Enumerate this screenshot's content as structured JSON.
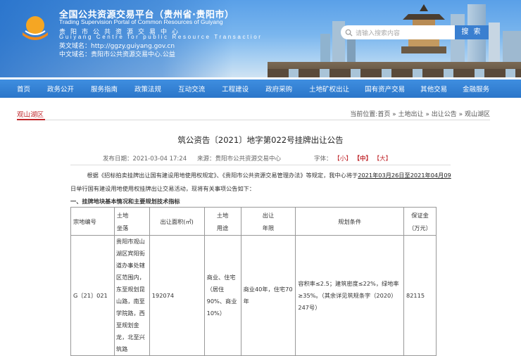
{
  "header": {
    "title_cn": "全国公共资源交易平台（贵州省·贵阳市）",
    "title_en": "Trading Supervision Portal of Common Resources of Guiyang",
    "subtitle_cn": "贵阳市公共资源交易中心",
    "subtitle_en": "Guiyang Centre for public Resource Transactior",
    "domain_en": "英文域名：http://ggzy.guiyang.gov.cn",
    "domain_cn": "中文域名：贵阳市公共资源交易中心.公益",
    "search_placeholder": "请输入搜索内容",
    "search_button": "搜 索"
  },
  "nav": {
    "items": [
      "首页",
      "政务公开",
      "服务指南",
      "政策法规",
      "互动交流",
      "工程建设",
      "政府采购",
      "土地矿权出让",
      "国有资产交易",
      "其他交易",
      "金融服务"
    ]
  },
  "breadcrumb": {
    "section": "观山湖区",
    "path": "当前位置:首页 » 土地出让 » 出让公告 » 观山湖区"
  },
  "article": {
    "title": "筑公资告〔2021〕地字第022号挂牌出让公告",
    "date": "发布日期：2021-03-04 17:24",
    "source": "来源：贵阳市公共资源交易中心",
    "font_label": "字体：",
    "font_small": "【小】",
    "font_medium": "【中】",
    "font_large": "【大】",
    "para1_pre": "根据《招标拍卖挂牌出让国有建设用地使用权规定》、《贵阳市公共资源交易管理办法》等规定，我中心将于",
    "para1_date1": "2021年03月26日",
    "para1_mid": "至",
    "para1_date2": "2021年04月09",
    "para2": "日举行国有建设用地使用权挂牌出让交易活动，现将有关事项公告如下：",
    "section1": "一、挂牌地块基本情况和主要规划技术指标"
  },
  "table": {
    "headers": {
      "parcel_no": "宗地编号",
      "location_1": "土地",
      "location_2": "坐落",
      "area": "出让面积(㎡)",
      "use_1": "土地",
      "use_2": "用途",
      "term_1": "出让",
      "term_2": "年限",
      "conditions": "规划条件",
      "deposit_1": "保证金",
      "deposit_2": "（万元）"
    },
    "rows": [
      {
        "parcel_no": "G〔21〕021",
        "location": "贵阳市观山湖区宾阳街道办事处辖区范围内，东至规划昆山路，南至学院路，西至规划金龙，北至兴筑路",
        "area": "192074",
        "use": "商业、住宅（居住90%、商业10%）",
        "term": "商业40年，住宅70年",
        "conditions": "容积率≤2.5；建筑密度≤22%，绿地率≥35%。（其余详见筑规条字（2020）247号）",
        "deposit": "82115"
      }
    ]
  },
  "colors": {
    "nav_blue": "#2f80d4",
    "accent_red": "#c0282d",
    "search_button": "#3a7fd0"
  },
  "icons": [
    "logo-icon",
    "search-icon"
  ]
}
